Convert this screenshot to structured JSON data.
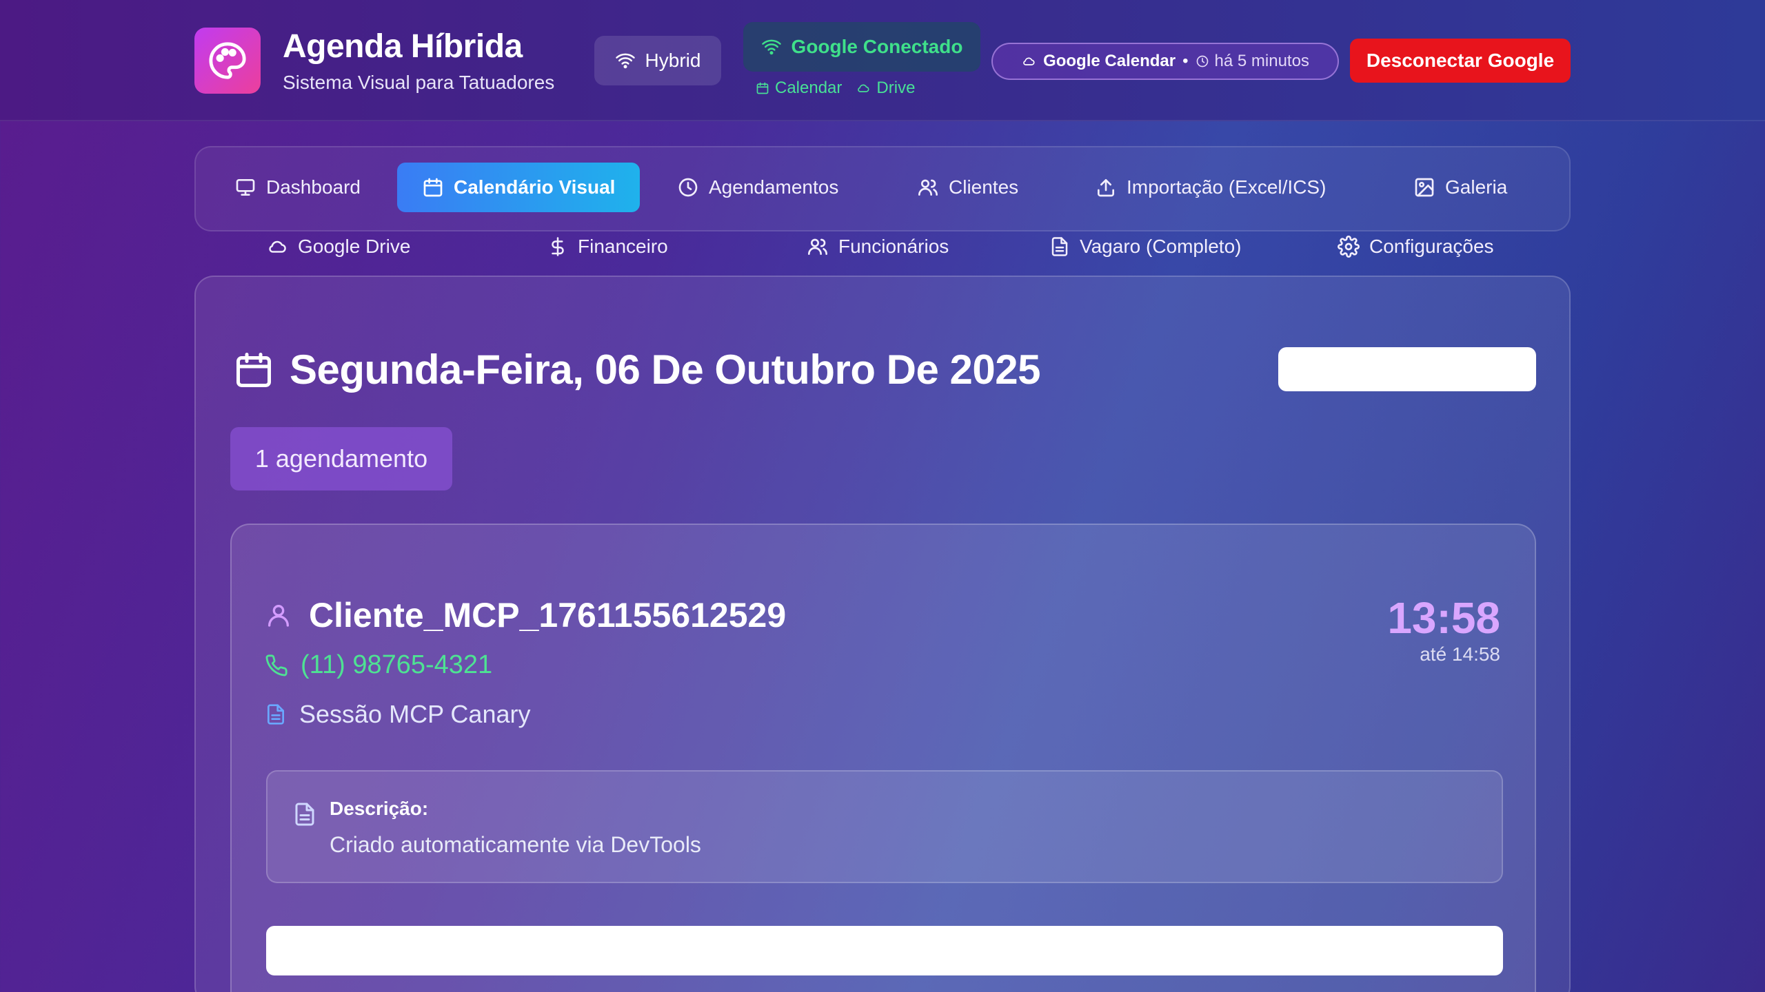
{
  "header": {
    "brand_title": "Agenda Híbrida",
    "brand_subtitle": "Sistema Visual para Tatuadores",
    "mode_label": "Hybrid",
    "google_status": "Google Conectado",
    "services": [
      "Calendar",
      "Drive"
    ],
    "calendar_pill": {
      "name": "Google Calendar",
      "separator": "•",
      "updated": "há 5 minutos"
    },
    "disconnect_label": "Desconectar Google"
  },
  "nav": {
    "row1": [
      {
        "label": "Dashboard",
        "icon": "monitor-icon"
      },
      {
        "label": "Calendário Visual",
        "icon": "calendar-icon",
        "active": true
      },
      {
        "label": "Agendamentos",
        "icon": "clock-icon"
      },
      {
        "label": "Clientes",
        "icon": "users-icon"
      },
      {
        "label": "Importação (Excel/ICS)",
        "icon": "upload-icon"
      },
      {
        "label": "Galeria",
        "icon": "image-icon"
      }
    ],
    "row2": [
      {
        "label": "Google Drive",
        "icon": "cloud-icon"
      },
      {
        "label": "Financeiro",
        "icon": "dollar-icon"
      },
      {
        "label": "Funcionários",
        "icon": "users-icon"
      },
      {
        "label": "Vagaro (Completo)",
        "icon": "file-icon"
      },
      {
        "label": "Configurações",
        "icon": "gear-icon"
      }
    ]
  },
  "main": {
    "date_title": "Segunda-Feira, 06 De Outubro De 2025",
    "count_badge": "1 agendamento",
    "appointment": {
      "client": "Cliente_MCP_1761155612529",
      "phone": "(11) 98765-4321",
      "service": "Sessão MCP Canary",
      "start": "13:58",
      "end": "até 14:58",
      "description_label": "Descrição:",
      "description": "Criado automaticamente via DevTools"
    }
  },
  "colors": {
    "accent_green": "#3fe08a",
    "disconnect_red": "#e8141c",
    "active_tab_start": "#3a7cf4",
    "active_tab_end": "#1fb2ec",
    "time_purple": "#d9a6ff"
  }
}
